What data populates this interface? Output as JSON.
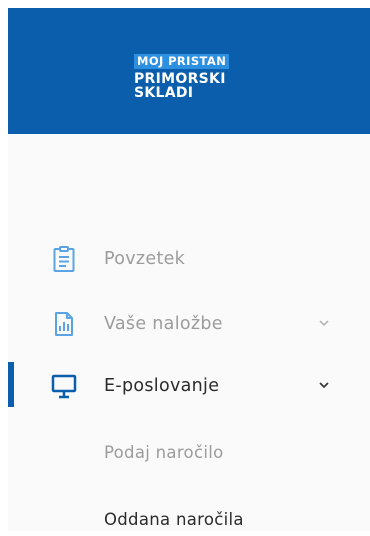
{
  "brand": {
    "top": "MOJ PRISTAN",
    "main": "PRIMORSKI SKLADI",
    "header_color": "#0a5eab",
    "badge_color": "#2d8fe0"
  },
  "nav": {
    "items": [
      {
        "label": "Povzetek",
        "icon": "clipboard-icon",
        "state": "muted"
      },
      {
        "label": "Vaše naložbe",
        "icon": "chart-document-icon",
        "state": "muted",
        "expandable": true
      },
      {
        "label": "E-poslovanje",
        "icon": "monitor-icon",
        "state": "active",
        "expandable": true
      }
    ],
    "subitems": [
      {
        "label": "Podaj naročilo",
        "state": "muted"
      },
      {
        "label": "Oddana naročila",
        "state": "dark"
      }
    ],
    "accent_color": "#0a5eab"
  }
}
